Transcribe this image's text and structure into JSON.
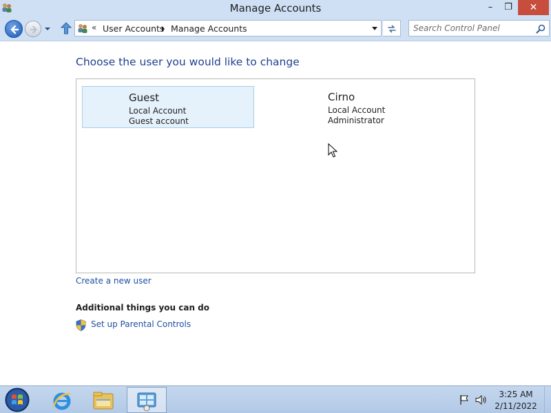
{
  "window": {
    "title": "Manage Accounts",
    "minimize_label": "–",
    "maximize_label": "❐",
    "close_label": "✕"
  },
  "navigation": {
    "breadcrumb_prefix": "«",
    "breadcrumb": [
      "User Accounts",
      "Manage Accounts"
    ],
    "search_placeholder": "Search Control Panel"
  },
  "main": {
    "heading": "Choose the user you would like to change",
    "accounts": [
      {
        "name": "Guest",
        "type": "Local Account",
        "detail": "Guest account",
        "selected": true
      },
      {
        "name": "Cirno",
        "type": "Local Account",
        "detail": "Administrator",
        "selected": false
      }
    ],
    "create_link": "Create a new user",
    "additional_heading": "Additional things you can do",
    "parental_link": "Set up Parental Controls"
  },
  "taskbar": {
    "time": "3:25 AM",
    "date": "2/11/2022",
    "pinned_icons": [
      "internet-explorer-icon",
      "file-explorer-icon",
      "control-panel-icon"
    ]
  },
  "colors": {
    "chrome": "#cfe0f5",
    "heading": "#1e3f91",
    "link": "#1e4fa3",
    "selected_tile": "#e5f1fb",
    "close_button": "#c74e3d"
  }
}
